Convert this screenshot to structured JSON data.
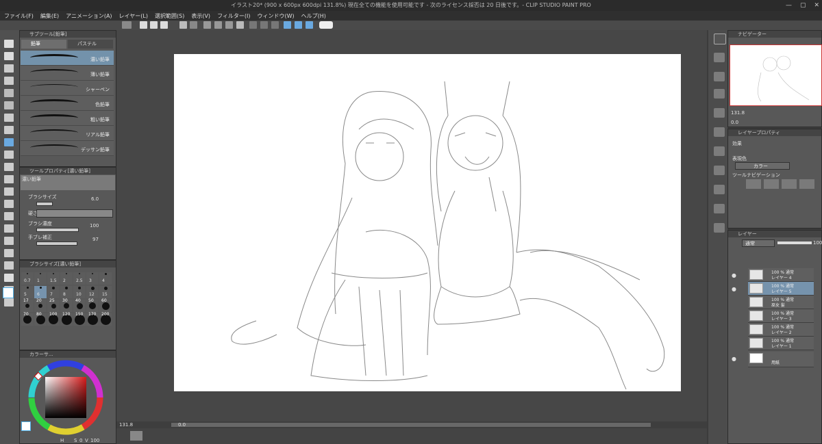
{
  "window": {
    "title": "イラスト20* (900 x 600px 600dpi 131.8%)  現在全ての機能を使用可能です - 次のライセンス採否は 20 日後です。- CLIP STUDIO PAINT PRO",
    "minimize": "—",
    "maximize": "▢",
    "close": "✕"
  },
  "menu": [
    "ファイル(F)",
    "編集(E)",
    "アニメーション(A)",
    "レイヤー(L)",
    "選択範囲(S)",
    "表示(V)",
    "フィルター(I)",
    "ウィンドウ(W)",
    "ヘルプ(H)"
  ],
  "subtool": {
    "header": "サブツール[鉛筆]",
    "tabs": [
      "鉛筆",
      "パステル"
    ],
    "brushes": [
      "濃い鉛筆",
      "薄い鉛筆",
      "シャーペン",
      "色鉛筆",
      "粗い鉛筆",
      "リアル鉛筆",
      "デッサン鉛筆"
    ]
  },
  "tool_property": {
    "header": "ツールプロパティ[濃い鉛筆]",
    "preset": "濃い鉛筆",
    "brush_size_label": "ブラシサイズ",
    "brush_size_value": "6.0",
    "hardness_label": "硬さ",
    "density_label": "ブラシ濃度",
    "density_value": "100",
    "stabilizer_label": "手ブレ補正",
    "stabilizer_value": "97"
  },
  "brush_size": {
    "header": "ブラシサイズ[濃い鉛筆]",
    "rows": [
      [
        "0.7",
        "1",
        "1.5",
        "2",
        "2.5",
        "3",
        "4"
      ],
      [
        "5",
        "6",
        "7",
        "8",
        "10",
        "12",
        "15"
      ],
      [
        "17",
        "20",
        "25",
        "30",
        "40",
        "50",
        "60"
      ],
      [
        "70",
        "80",
        "100",
        "120",
        "150",
        "170",
        "200"
      ]
    ]
  },
  "color": {
    "header": "カラーサ...",
    "h": "H",
    "s": "S",
    "s_value": "0",
    "v": "V",
    "v_value": "100"
  },
  "navigator": {
    "header": "ナビゲーター"
  },
  "zoom_value": "131.8",
  "angle_value": "0.0",
  "status_zoom": "131.8",
  "status_angle": "0.0",
  "layer_property": {
    "header": "レイヤープロパティ",
    "effect_label": "効果",
    "expression_label": "表現色",
    "expression_value": "カラー",
    "tool_nav_label": "ツールナビゲーション"
  },
  "layer_panel": {
    "header": "レイヤー",
    "blend": "通常",
    "opacity": "100",
    "layers": [
      {
        "line1": "100 % 通常",
        "line2": "レイヤー 4"
      },
      {
        "line1": "100 % 通常",
        "line2": "レイヤー 5"
      },
      {
        "line1": "100 % 通常",
        "line2": "巫女 髪"
      },
      {
        "line1": "100 % 通常",
        "line2": "レイヤー 3"
      },
      {
        "line1": "100 % 通常",
        "line2": "レイヤー 2"
      },
      {
        "line1": "100 % 通常",
        "line2": "レイヤー 1"
      },
      {
        "line1": "",
        "line2": "用紙"
      }
    ]
  },
  "colors": {
    "accent": "#4fb0e8",
    "panel": "#585858",
    "canvas_bg": "#474747",
    "paper": "#ffffff"
  }
}
